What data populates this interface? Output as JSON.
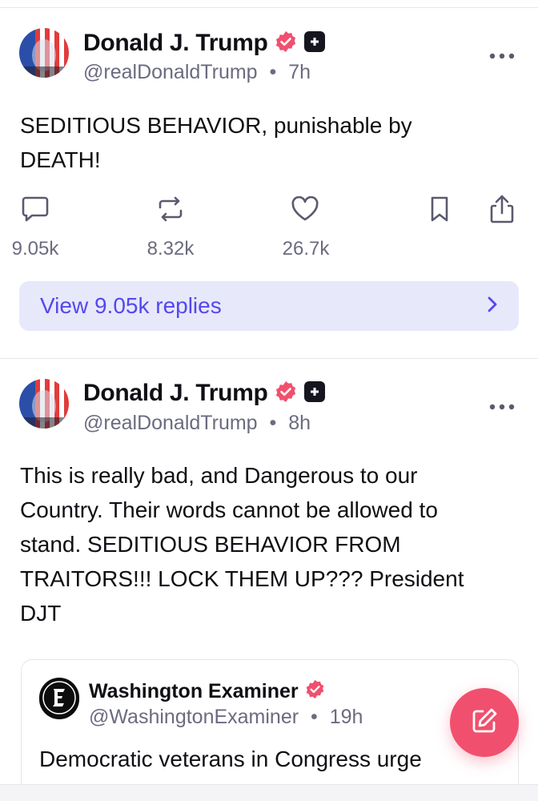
{
  "posts": [
    {
      "display_name": "Donald J. Trump",
      "handle": "@realDonaldTrump",
      "separator": "•",
      "time": "7h",
      "text_lines": [
        "SEDITIOUS BEHAVIOR, punishable by",
        "DEATH!"
      ],
      "counts": {
        "replies": "9.05k",
        "reposts": "8.32k",
        "likes": "26.7k"
      },
      "view_replies": "View 9.05k replies"
    },
    {
      "display_name": "Donald J. Trump",
      "handle": "@realDonaldTrump",
      "separator": "•",
      "time": "8h",
      "text_lines": [
        "This is really bad, and Dangerous to our",
        "Country. Their words cannot be allowed to",
        "stand. SEDITIOUS BEHAVIOR FROM",
        "TRAITORS!!! LOCK THEM UP??? President",
        "DJT"
      ],
      "quote": {
        "display_name": "Washington Examiner",
        "handle": "@WashingtonExaminer",
        "separator": "•",
        "time": "19h",
        "text": "Democratic veterans in Congress urge"
      }
    }
  ],
  "colors": {
    "accent": "#5448ee",
    "verified_badge": "#f0506e",
    "compose_button": "#f0506e",
    "muted_text": "#6b6b80",
    "view_replies_bg": "#e8e8fb"
  },
  "icons": {
    "verified": "verified-badge-icon",
    "plus_badge": "plus-badge-icon",
    "more": "more-dots-icon",
    "reply": "reply-bubble-icon",
    "repost": "repost-icon",
    "like": "heart-icon",
    "bookmark": "bookmark-icon",
    "share": "share-icon",
    "chevron": "chevron-right-icon",
    "compose": "compose-icon"
  }
}
